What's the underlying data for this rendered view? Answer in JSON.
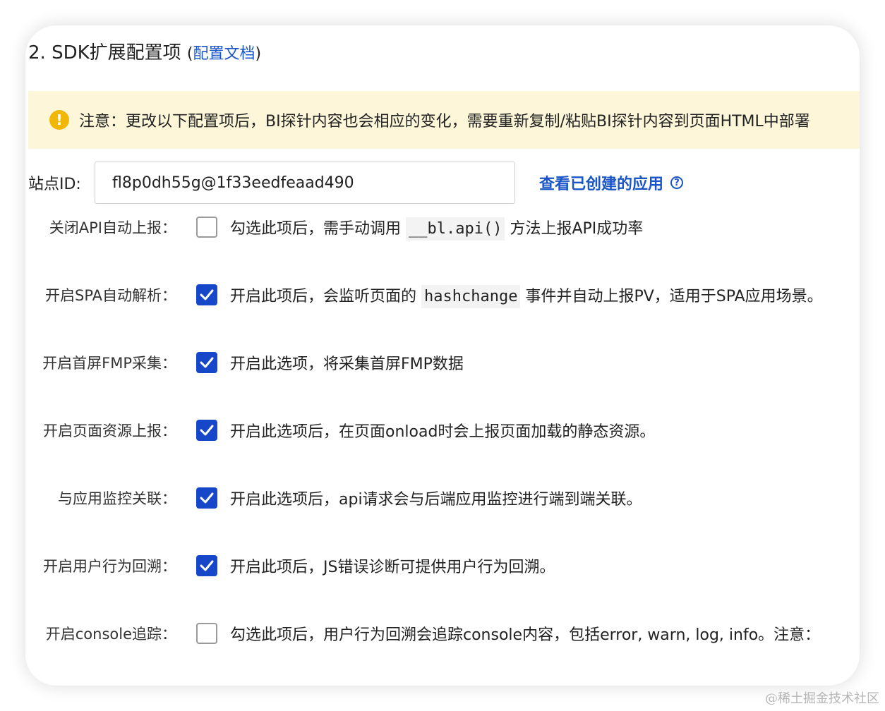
{
  "section": {
    "title": "2. SDK扩展配置项",
    "paren_open": "(",
    "doc_link": "配置文档",
    "paren_close": ")"
  },
  "notice": {
    "icon": "warning-icon",
    "icon_glyph": "!",
    "text": "注意：更改以下配置项后，BI探针内容也会相应的变化，需要重新复制/粘贴BI探针内容到页面HTML中部署"
  },
  "site": {
    "label": "站点ID:",
    "value": "fl8p0dh55g@1f33eedfeaad490",
    "view_link": "查看已创建的应用",
    "help_icon": "question-circle-icon",
    "help_glyph": "?"
  },
  "options": [
    {
      "label": "关闭API自动上报：",
      "checked": false,
      "desc_before": "勾选此项后，需手动调用",
      "code": "__bl.api()",
      "desc_after": "方法上报API成功率"
    },
    {
      "label": "开启SPA自动解析：",
      "checked": true,
      "desc_before": "开启此项后，会监听页面的",
      "code": "hashchange",
      "desc_after": "事件并自动上报PV，适用于SPA应用场景。"
    },
    {
      "label": "开启首屏FMP采集：",
      "checked": true,
      "desc": "开启此选项，将采集首屏FMP数据"
    },
    {
      "label": "开启页面资源上报：",
      "checked": true,
      "desc": "开启此选项后，在页面onload时会上报页面加载的静态资源。"
    },
    {
      "label": "与应用监控关联：",
      "checked": true,
      "desc": "开启此选项后，api请求会与后端应用监控进行端到端关联。"
    },
    {
      "label": "开启用户行为回溯：",
      "checked": true,
      "desc": "开启此项后，JS错误诊断可提供用户行为回溯。"
    },
    {
      "label": "开启console追踪：",
      "checked": false,
      "desc": "勾选此项后，用户行为回溯会追踪console内容，包括error, warn, log, info。注意："
    }
  ],
  "watermark": "@稀土掘金技术社区",
  "colors": {
    "accent": "#1747c9",
    "link": "#1a55c7",
    "notice_bg": "#fdf6d9",
    "warning": "#f2b705"
  }
}
